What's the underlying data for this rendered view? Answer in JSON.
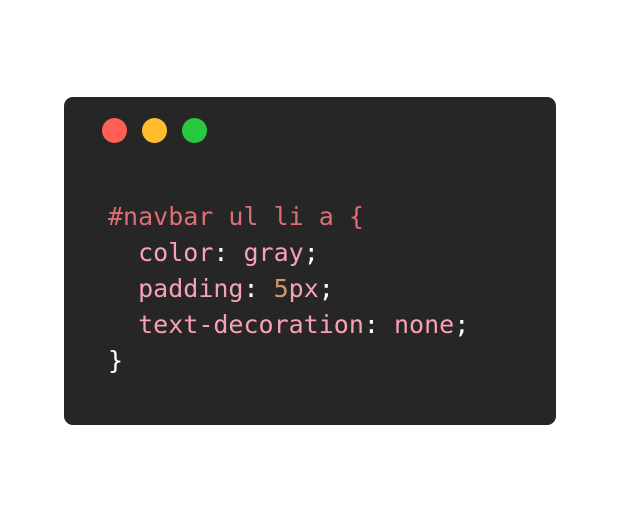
{
  "window": {
    "controls": [
      {
        "name": "close",
        "color": "#ff5f56"
      },
      {
        "name": "minimize",
        "color": "#ffbd2e"
      },
      {
        "name": "maximize",
        "color": "#27c93f"
      }
    ]
  },
  "colors": {
    "selector": "#e06c75",
    "property": "#f7a1b5",
    "value_keyword": "#f7a1b5",
    "value_number": "#d19a66",
    "punctuation": "#ffffff",
    "background": "#262626"
  },
  "code": {
    "line1": {
      "selector": "#navbar ul li a",
      "brace_open": " {"
    },
    "line2": {
      "indent": "  ",
      "property": "color",
      "colon": ": ",
      "value": "gray",
      "semicolon": ";"
    },
    "line3": {
      "indent": "  ",
      "property": "padding",
      "colon": ": ",
      "value_number": "5",
      "value_unit": "px",
      "semicolon": ";"
    },
    "line4": {
      "indent": "  ",
      "property": "text-decoration",
      "colon": ": ",
      "value": "none",
      "semicolon": ";"
    },
    "line5": {
      "brace_close": "}"
    }
  }
}
